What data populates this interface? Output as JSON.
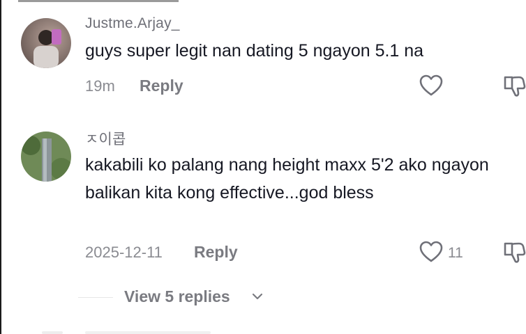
{
  "comments": [
    {
      "username": "Justme.Arjay_",
      "text": "guys super legit nan dating 5 ngayon 5.1 na",
      "time": "19m",
      "reply_label": "Reply",
      "likes": ""
    },
    {
      "username": "ㅈ이콥",
      "text": "kakabili ko palang nang height maxx 5'2 ako ngayon balikan kita kong effective...god bless",
      "time": "2025-12-11",
      "reply_label": "Reply",
      "likes": "11"
    }
  ],
  "view_replies": {
    "label": "View 5 replies"
  },
  "icons": {
    "like": "heart-outline-icon",
    "dislike": "thumbs-down-outline-icon",
    "expand": "chevron-down-icon"
  },
  "colors": {
    "text": "#161823",
    "secondary": "#8a8b91",
    "icon": "#6f7078"
  }
}
